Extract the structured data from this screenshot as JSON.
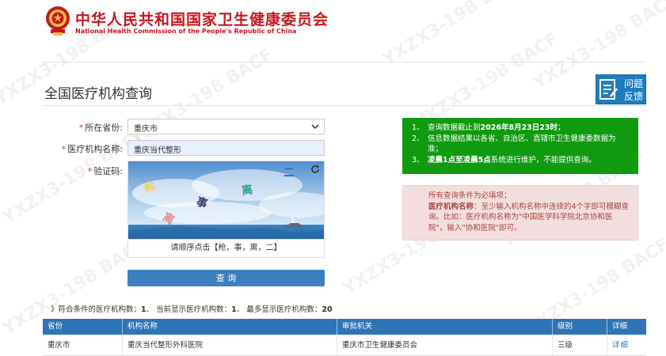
{
  "header": {
    "org_name_cn": "中华人民共和国国家卫生健康委员会",
    "org_name_en": "National Health Commission of the People's Republic of China"
  },
  "page": {
    "title": "全国医疗机构查询",
    "feedback_label": "问题反馈"
  },
  "form": {
    "province_label": "所在省份:",
    "province_value": "重庆市",
    "name_label": "医疗机构名称:",
    "name_value": "重庆当代整形",
    "captcha_label": "验证码:",
    "captcha_chars": [
      "枪",
      "事",
      "离",
      "二"
    ],
    "captcha_prompt": "请顺序点击【枪，事，离，二】",
    "query_button": "查 询"
  },
  "notice_green": {
    "items": [
      {
        "num": "1、",
        "pre": "查询数据截止到",
        "bold": "2026年8月23日23时",
        "post": "；"
      },
      {
        "num": "2、",
        "pre": "信息数据结果以各省、自治区、直辖市卫生健康委数据为准；",
        "bold": "",
        "post": ""
      },
      {
        "num": "3、",
        "pre": "",
        "bold": "凌晨1点至凌晨5点",
        "post": "系统进行维护，不能提供查询。"
      }
    ]
  },
  "notice_pink": {
    "line1": "所有查询条件为必填项；",
    "bold": "医疗机构名称",
    "line2": "：至少输入机构名称中连续的4个字即可模糊查询。比如：医疗机构名称为\"中国医学科学院北京协和医院\"，输入\"协和医院\"即可。"
  },
  "summary": {
    "prefix": "》符合条件的医疗机构数：",
    "match_count": "1",
    "mid1": "、 当前显示医疗机构数：",
    "shown_count": "1",
    "mid2": "、 最多显示医疗机构数：",
    "max_count": "20"
  },
  "table": {
    "headers": [
      "省份",
      "机构名称",
      "审批机关",
      "级别",
      "详细"
    ],
    "rows": [
      {
        "province": "重庆市",
        "name": "重庆当代整形外科医院",
        "authority": "重庆市卫生健康委员会",
        "level": "三级",
        "detail": "详细"
      }
    ]
  },
  "watermark": "YXZX3-198 BACF",
  "colors": {
    "brand_red": "#c8161d",
    "primary_blue": "#2f74b5",
    "notice_green": "#109a10",
    "notice_pink": "#f2dede"
  }
}
